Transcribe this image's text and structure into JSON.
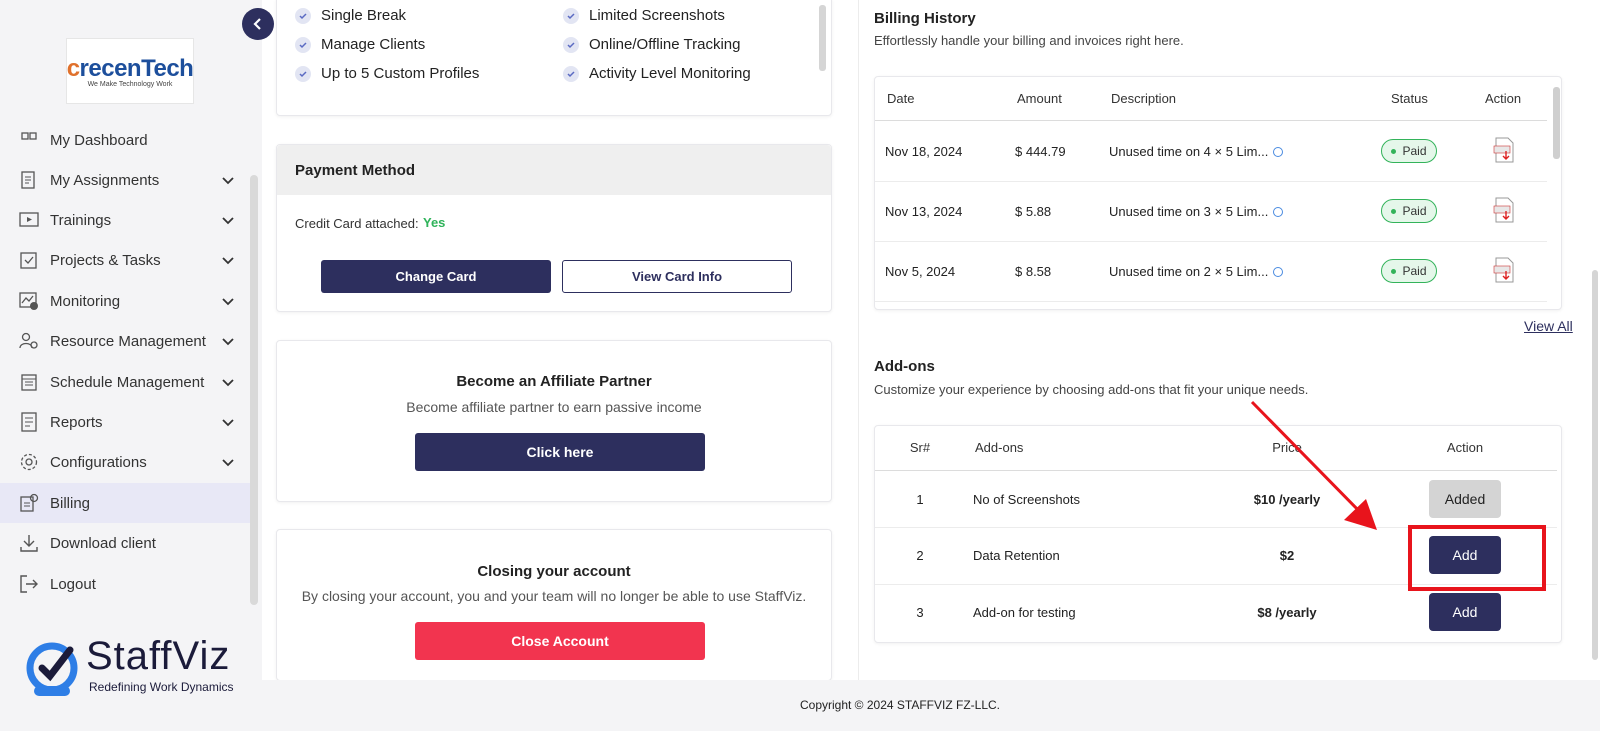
{
  "sidebar": {
    "logo": {
      "main": "recenTech",
      "lead": "c",
      "tagline": "We Make Technology Work"
    },
    "items": [
      {
        "label": "My Dashboard",
        "icon": "dashboard-icon"
      },
      {
        "label": "My Assignments",
        "icon": "assignments-icon"
      },
      {
        "label": "Trainings",
        "icon": "trainings-icon"
      },
      {
        "label": "Projects & Tasks",
        "icon": "projects-icon"
      },
      {
        "label": "Monitoring",
        "icon": "monitoring-icon"
      },
      {
        "label": "Resource Management",
        "icon": "resource-icon"
      },
      {
        "label": "Schedule Management",
        "icon": "schedule-icon"
      },
      {
        "label": "Reports",
        "icon": "reports-icon"
      },
      {
        "label": "Configurations",
        "icon": "configurations-icon"
      },
      {
        "label": "Billing",
        "icon": "billing-icon"
      },
      {
        "label": "Download client",
        "icon": "download-icon"
      },
      {
        "label": "Logout",
        "icon": "logout-icon"
      }
    ],
    "brand": {
      "name": "StaffViz",
      "tagline": "Redefining Work Dynamics"
    }
  },
  "plan_features": {
    "col1": [
      "Single Break",
      "Manage Clients",
      "Up to 5 Custom Profiles"
    ],
    "col2": [
      "Limited Screenshots",
      "Online/Offline Tracking",
      "Activity Level Monitoring"
    ]
  },
  "payment": {
    "title": "Payment Method",
    "card_attached_label": "Credit Card attached:",
    "card_attached_value": "Yes",
    "change_card": "Change Card",
    "view_card": "View Card Info"
  },
  "affiliate": {
    "title": "Become an Affiliate Partner",
    "subtitle": "Become affiliate partner to earn passive income",
    "button": "Click here"
  },
  "closing": {
    "title": "Closing your account",
    "subtitle": "By closing your account, you and your team will no longer be able to use StaffViz.",
    "button": "Close Account"
  },
  "billing": {
    "title": "Billing History",
    "subtitle": "Effortlessly handle your billing and invoices right here.",
    "headers": [
      "Date",
      "Amount",
      "Description",
      "Status",
      "Action"
    ],
    "rows": [
      {
        "date": "Nov 18, 2024",
        "amount": "$ 444.79",
        "description": "Unused time on 4 × 5 Lim...",
        "status": "Paid"
      },
      {
        "date": "Nov 13, 2024",
        "amount": "$ 5.88",
        "description": "Unused time on 3 × 5 Lim...",
        "status": "Paid"
      },
      {
        "date": "Nov 5, 2024",
        "amount": "$ 8.58",
        "description": "Unused time on 2 × 5 Lim...",
        "status": "Paid"
      }
    ],
    "view_all": "View All"
  },
  "addons": {
    "title": "Add-ons",
    "subtitle": "Customize your experience by choosing add-ons that fit your unique needs.",
    "headers": [
      "Sr#",
      "Add-ons",
      "Price",
      "Action"
    ],
    "rows": [
      {
        "sr": "1",
        "name": "No of Screenshots",
        "price": "$10 /yearly",
        "action": "Added"
      },
      {
        "sr": "2",
        "name": "Data Retention",
        "price": "$2",
        "action": "Add"
      },
      {
        "sr": "3",
        "name": "Add-on for testing",
        "price": "$8 /yearly",
        "action": "Add"
      }
    ]
  },
  "footer": {
    "copyright": "Copyright © 2024 STAFFVIZ FZ-LLC."
  },
  "colors": {
    "primary": "#2d2f5e",
    "danger": "#f2344f",
    "success": "#33b35a",
    "annotation": "#e8141c"
  }
}
